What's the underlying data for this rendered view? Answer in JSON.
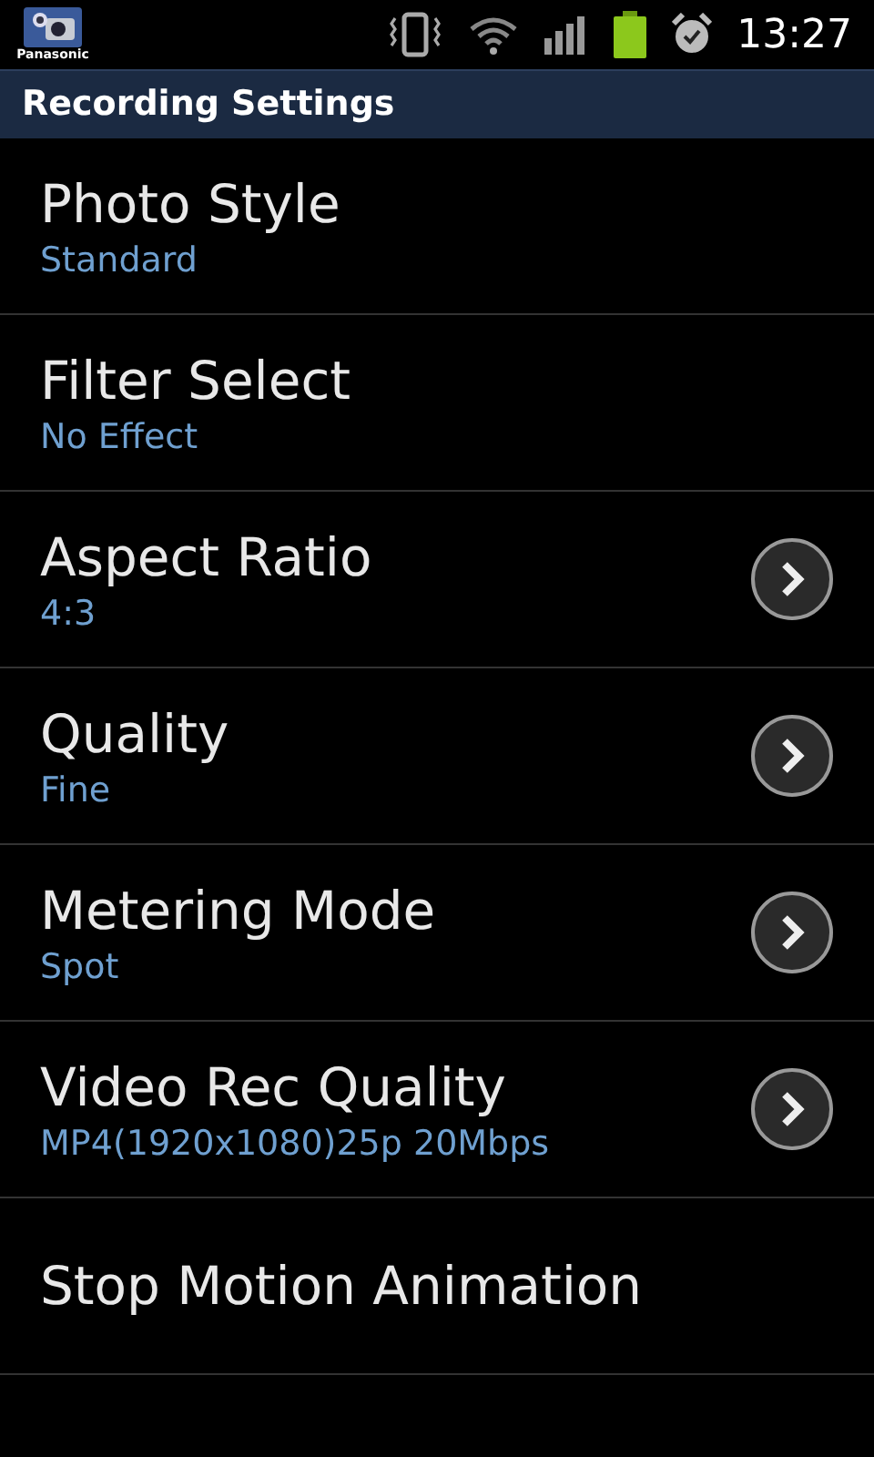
{
  "status_bar": {
    "app_label": "Panasonic",
    "time": "13:27"
  },
  "header": {
    "title": "Recording Settings"
  },
  "settings": [
    {
      "title": "Photo Style",
      "value": "Standard",
      "arrow": false
    },
    {
      "title": "Filter Select",
      "value": "No Effect",
      "arrow": false
    },
    {
      "title": "Aspect Ratio",
      "value": "4:3",
      "arrow": true
    },
    {
      "title": "Quality",
      "value": "Fine",
      "arrow": true
    },
    {
      "title": "Metering Mode",
      "value": "Spot",
      "arrow": true
    },
    {
      "title": "Video Rec Quality",
      "value": "MP4(1920x1080)25p 20Mbps",
      "arrow": true
    },
    {
      "title": "Stop Motion Animation",
      "arrow": false
    }
  ]
}
